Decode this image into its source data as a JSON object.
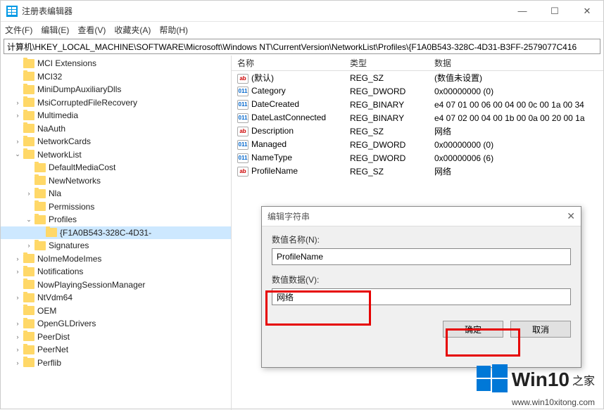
{
  "window": {
    "title": "注册表编辑器",
    "menu": [
      "文件(F)",
      "编辑(E)",
      "查看(V)",
      "收藏夹(A)",
      "帮助(H)"
    ],
    "address": "计算机\\HKEY_LOCAL_MACHINE\\SOFTWARE\\Microsoft\\Windows NT\\CurrentVersion\\NetworkList\\Profiles\\{F1A0B543-328C-4D31-B3FF-2579077C416"
  },
  "tree": [
    {
      "depth": 6,
      "caret": "",
      "label": "MCI Extensions"
    },
    {
      "depth": 6,
      "caret": "",
      "label": "MCI32"
    },
    {
      "depth": 6,
      "caret": "",
      "label": "MiniDumpAuxiliaryDlls"
    },
    {
      "depth": 6,
      "caret": ">",
      "label": "MsiCorruptedFileRecovery"
    },
    {
      "depth": 6,
      "caret": ">",
      "label": "Multimedia"
    },
    {
      "depth": 6,
      "caret": "",
      "label": "NaAuth"
    },
    {
      "depth": 6,
      "caret": ">",
      "label": "NetworkCards"
    },
    {
      "depth": 6,
      "caret": "v",
      "label": "NetworkList"
    },
    {
      "depth": 7,
      "caret": "",
      "label": "DefaultMediaCost"
    },
    {
      "depth": 7,
      "caret": "",
      "label": "NewNetworks"
    },
    {
      "depth": 7,
      "caret": ">",
      "label": "Nla"
    },
    {
      "depth": 7,
      "caret": "",
      "label": "Permissions"
    },
    {
      "depth": 7,
      "caret": "v",
      "label": "Profiles"
    },
    {
      "depth": 8,
      "caret": "",
      "label": "{F1A0B543-328C-4D31-",
      "sel": true
    },
    {
      "depth": 7,
      "caret": ">",
      "label": "Signatures"
    },
    {
      "depth": 6,
      "caret": ">",
      "label": "NoImeModeImes"
    },
    {
      "depth": 6,
      "caret": ">",
      "label": "Notifications"
    },
    {
      "depth": 6,
      "caret": "",
      "label": "NowPlayingSessionManager"
    },
    {
      "depth": 6,
      "caret": ">",
      "label": "NtVdm64"
    },
    {
      "depth": 6,
      "caret": "",
      "label": "OEM"
    },
    {
      "depth": 6,
      "caret": ">",
      "label": "OpenGLDrivers"
    },
    {
      "depth": 6,
      "caret": ">",
      "label": "PeerDist"
    },
    {
      "depth": 6,
      "caret": ">",
      "label": "PeerNet"
    },
    {
      "depth": 6,
      "caret": ">",
      "label": "Perflib"
    }
  ],
  "columns": {
    "name": "名称",
    "type": "类型",
    "data": "数据"
  },
  "values": [
    {
      "icon": "str",
      "name": "(默认)",
      "type": "REG_SZ",
      "data": "(数值未设置)"
    },
    {
      "icon": "bin",
      "name": "Category",
      "type": "REG_DWORD",
      "data": "0x00000000 (0)"
    },
    {
      "icon": "bin",
      "name": "DateCreated",
      "type": "REG_BINARY",
      "data": "e4 07 01 00 06 00 04 00 0c 00 1a 00 34"
    },
    {
      "icon": "bin",
      "name": "DateLastConnected",
      "type": "REG_BINARY",
      "data": "e4 07 02 00 04 00 1b 00 0a 00 20 00 1a"
    },
    {
      "icon": "str",
      "name": "Description",
      "type": "REG_SZ",
      "data": "网络"
    },
    {
      "icon": "bin",
      "name": "Managed",
      "type": "REG_DWORD",
      "data": "0x00000000 (0)"
    },
    {
      "icon": "bin",
      "name": "NameType",
      "type": "REG_DWORD",
      "data": "0x00000006 (6)"
    },
    {
      "icon": "str",
      "name": "ProfileName",
      "type": "REG_SZ",
      "data": "网络"
    }
  ],
  "dialog": {
    "title": "编辑字符串",
    "name_label": "数值名称(N):",
    "name_value": "ProfileName",
    "data_label": "数值数据(V):",
    "data_value": "网络",
    "ok": "确定",
    "cancel": "取消"
  },
  "watermark": {
    "brand": "Win10",
    "suffix": "之家",
    "url": "www.win10xitong.com"
  }
}
